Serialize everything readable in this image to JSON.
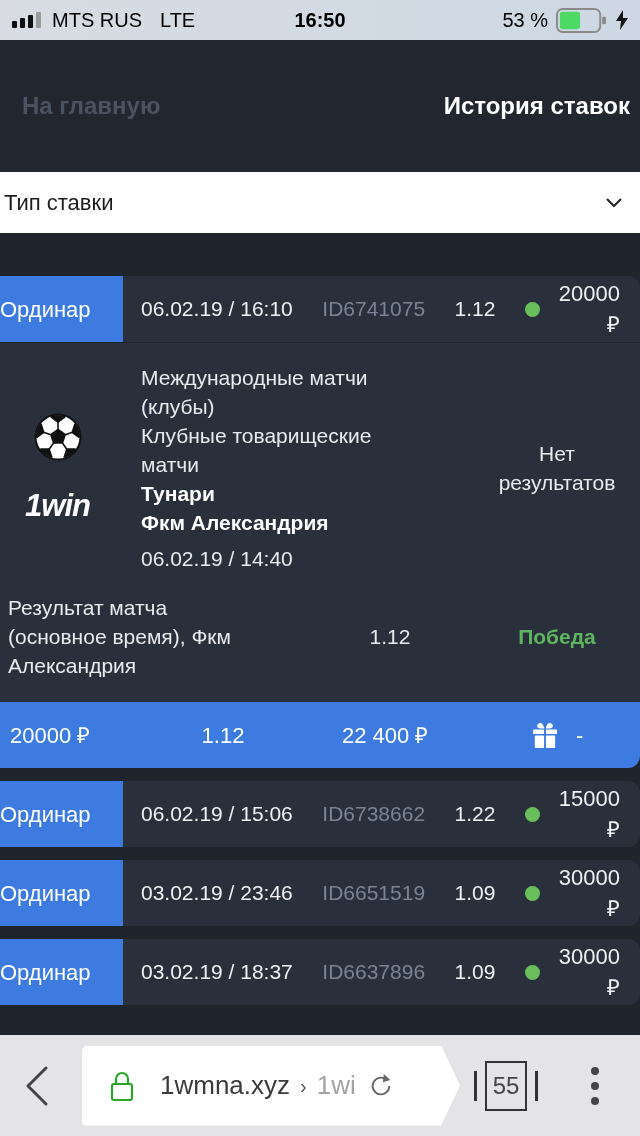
{
  "status_bar": {
    "carrier": "MTS RUS",
    "network": "LTE",
    "time": "16:50",
    "battery": "53 %"
  },
  "header": {
    "nav": [
      {
        "label": "На главную",
        "selected": false
      },
      {
        "label": "История ставок",
        "selected": true
      }
    ]
  },
  "filter": {
    "value": "Тип ставки"
  },
  "bets": [
    {
      "type": "Ординар",
      "datetime": "06.02.19 / 16:10",
      "id": "ID6741075",
      "odds": "1.12",
      "color": "#6abf5d",
      "amount": "20000 ₽",
      "expanded": true,
      "details": {
        "logo": "1win",
        "tournament": "Международные матчи (клубы)",
        "league": "Клубные товарищеские матчи",
        "team_1": "Тунари",
        "team_2": "Фкм Александрия",
        "start": "06.02.19 / 14:40",
        "score": "Нет результатов",
        "selection": "Результат матча (основное время), Фкм Александрия",
        "selection_odds": "1.12",
        "outcome": {
          "label": "Победа",
          "kind": "win"
        }
      },
      "summary": {
        "stake": "20000 ₽",
        "odds": "1.12",
        "payout": "22 400 ₽",
        "bonus": "-"
      }
    },
    {
      "type": "Ординар",
      "datetime": "06.02.19 / 15:06",
      "id": "ID6738662",
      "odds": "1.22",
      "color": "#6abf5d",
      "amount": "15000 ₽",
      "expanded": false
    },
    {
      "type": "Ординар",
      "datetime": "03.02.19 / 23:46",
      "id": "ID6651519",
      "odds": "1.09",
      "color": "#6abf5d",
      "amount": "30000 ₽",
      "expanded": false
    },
    {
      "type": "Ординар",
      "datetime": "03.02.19 / 18:37",
      "id": "ID6637896",
      "odds": "1.09",
      "color": "#6abf5d",
      "amount": "30000 ₽",
      "expanded": false
    }
  ],
  "browser_bar": {
    "domain": "1wmna.xyz",
    "separator": "›",
    "path": "1wi",
    "tabs": "55"
  }
}
